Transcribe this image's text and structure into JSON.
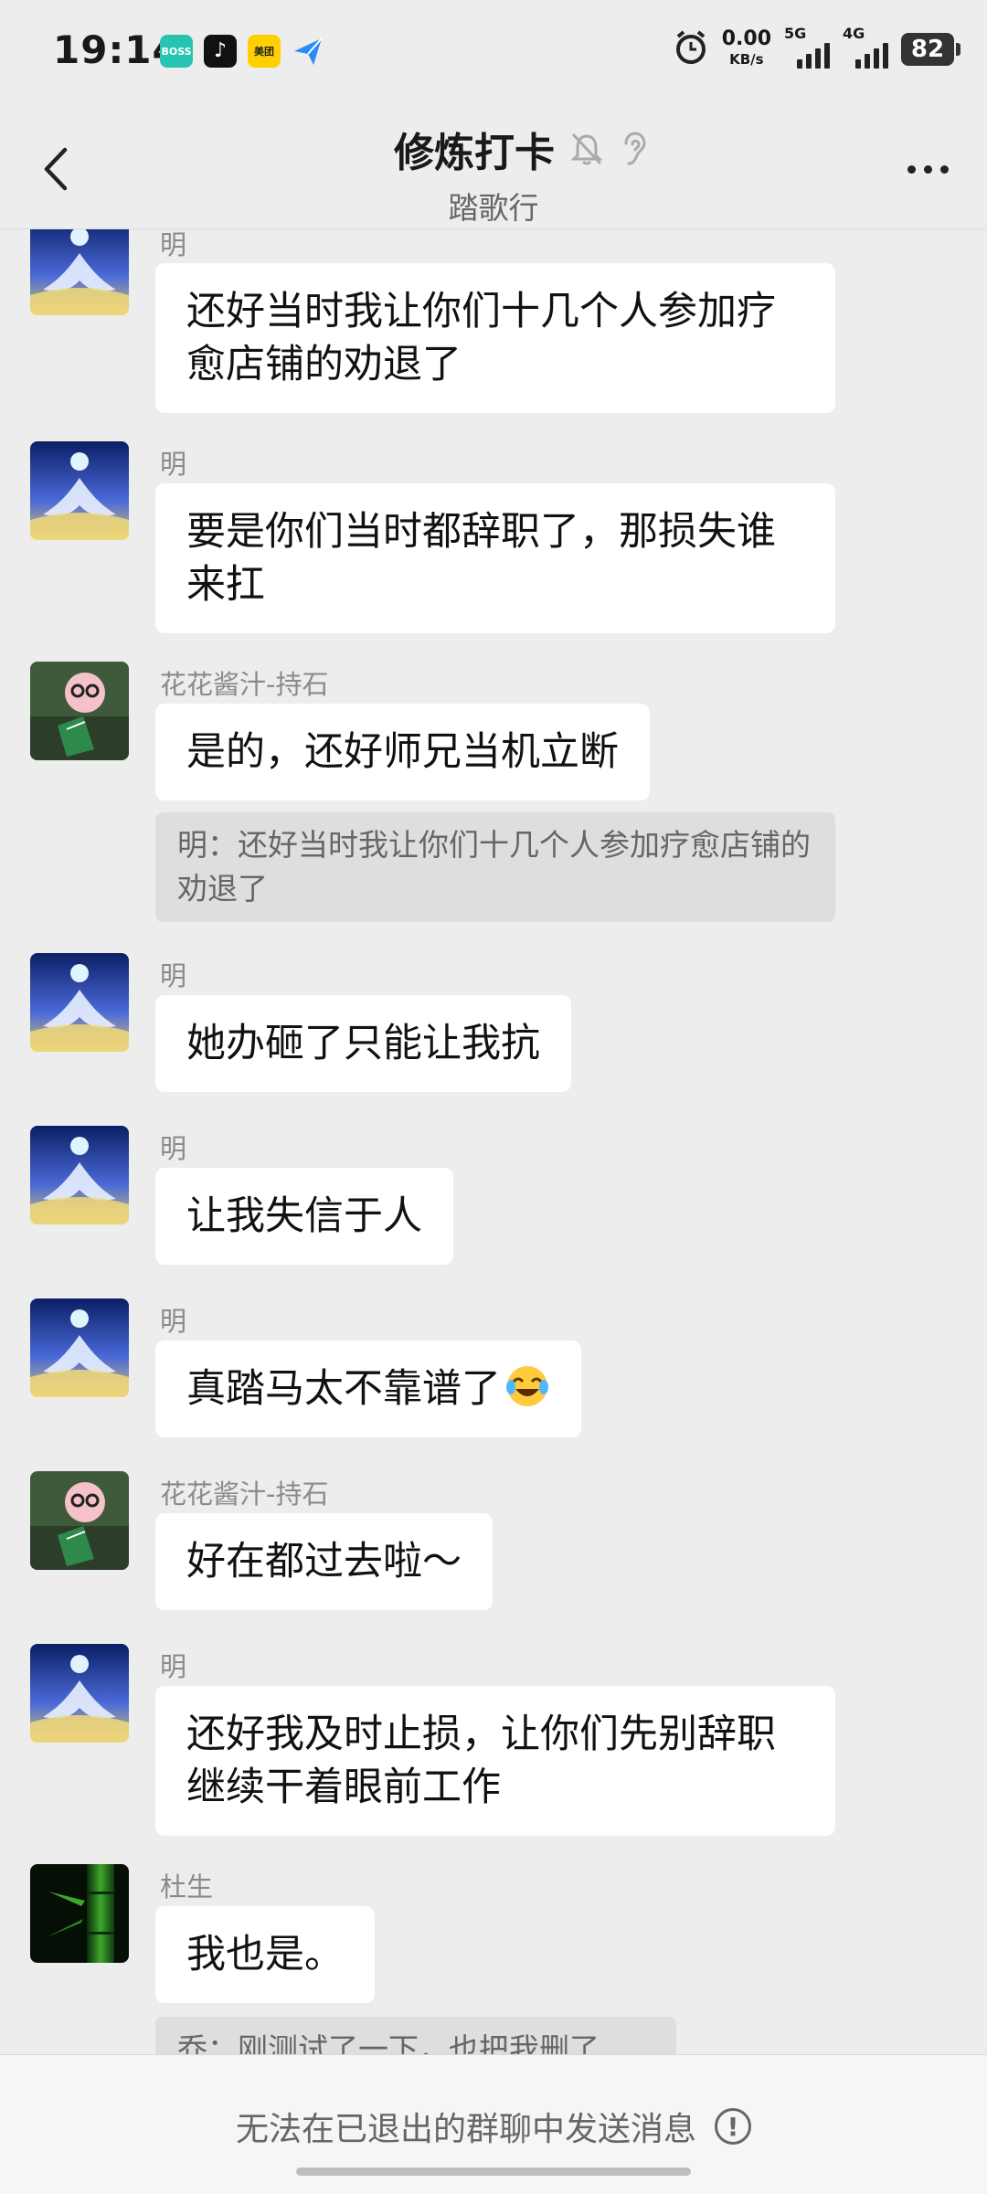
{
  "status": {
    "time": "19:14",
    "net_speed": "0.00",
    "net_unit": "KB/s",
    "sig1_label": "5G",
    "sig2_label": "4G",
    "battery": "82",
    "apps": [
      "BOSS\n直聘",
      "♪",
      "美团",
      "plane-icon"
    ]
  },
  "header": {
    "title": "修炼打卡",
    "subtitle": "踏歌行"
  },
  "colors": {
    "bg": "#ededed",
    "bubble": "#ffffff",
    "quote": "#dedede",
    "sender": "#8a8a8a"
  },
  "messages": [
    {
      "sender": "明",
      "text": "还好当时我让你们十几个人参加疗愈店铺的劝退了",
      "avatar": "lotus"
    },
    {
      "sender": "明",
      "text": "要是你们当时都辞职了，那损失谁来扛",
      "avatar": "lotus"
    },
    {
      "sender": "花花酱汁-持石",
      "text": "是的，还好师兄当机立断",
      "avatar": "pig",
      "quote": "明：还好当时我让你们十几个人参加疗愈店铺的劝退了"
    },
    {
      "sender": "明",
      "text": "她办砸了只能让我抗",
      "avatar": "lotus"
    },
    {
      "sender": "明",
      "text": "让我失信于人",
      "avatar": "lotus"
    },
    {
      "sender": "明",
      "text": "真踏马太不靠谱了",
      "avatar": "lotus",
      "emoji": "😂"
    },
    {
      "sender": "花花酱汁-持石",
      "text": "好在都过去啦～",
      "avatar": "pig"
    },
    {
      "sender": "明",
      "text": "还好我及时止损，让你们先别辞职继续干着眼前工作",
      "avatar": "lotus"
    },
    {
      "sender": "杜生",
      "text": "我也是。",
      "avatar": "bamboo",
      "quote": "乔：刚测试了一下，也把我删了"
    }
  ],
  "footer": {
    "notice": "无法在已退出的群聊中发送消息",
    "notice_icon": "!"
  }
}
